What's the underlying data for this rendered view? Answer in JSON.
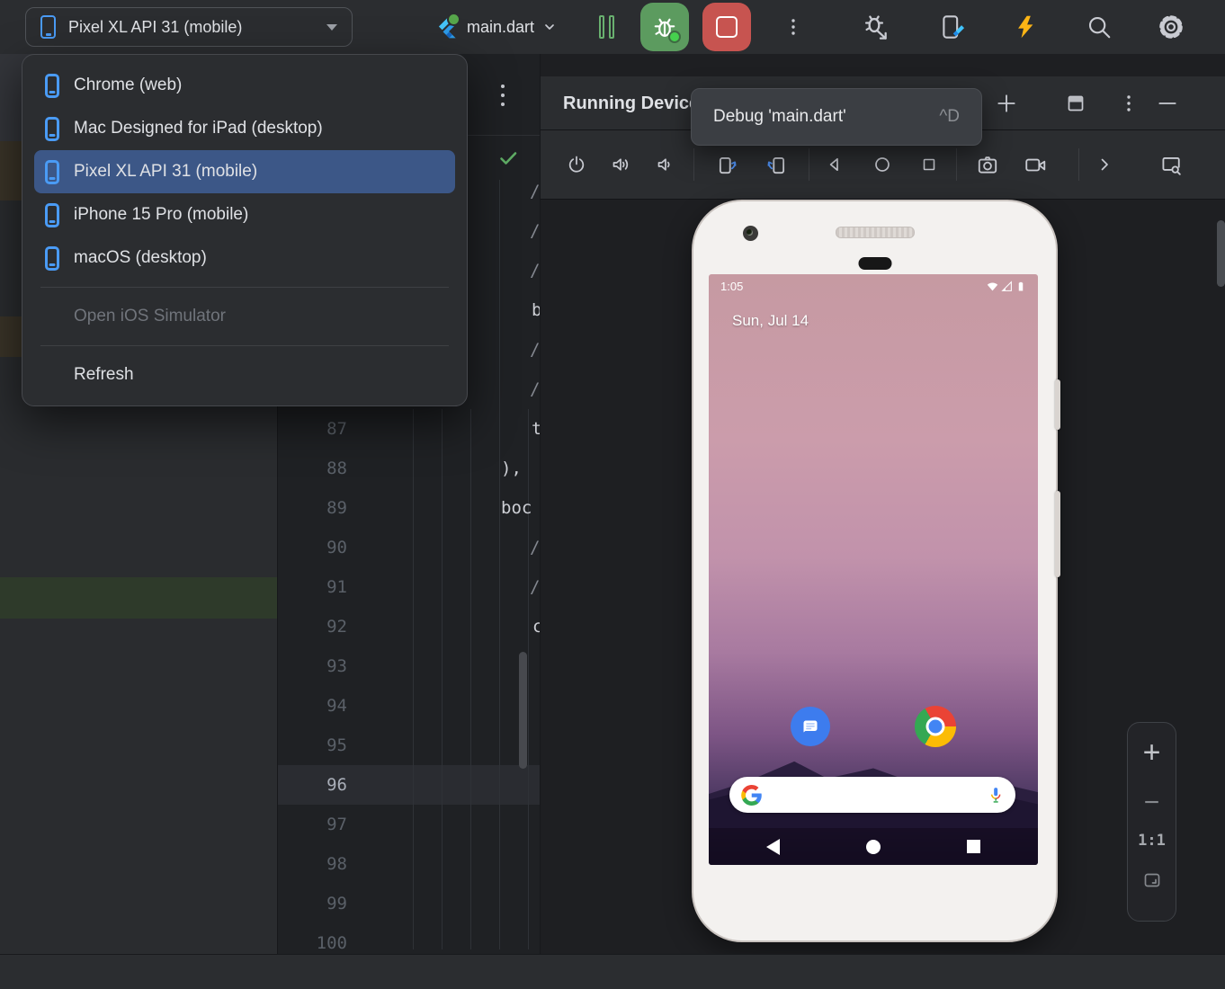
{
  "colors": {
    "accent_blue": "#4A9BF5",
    "selection_blue": "#3C5787",
    "run_green": "#5C9B5F",
    "stop_red": "#C75450",
    "hot_reload_yellow": "#FDB515",
    "check_green": "#5FAD65",
    "toolbar_bg": "#2B2D30",
    "editor_bg": "#1F2124",
    "project_panel_bg": "#2A2C2F"
  },
  "toolbar": {
    "device_selector": {
      "label": "Pixel XL API 31 (mobile)",
      "icon": "device-phone-icon"
    },
    "run_config": {
      "label": "main.dart",
      "icon": "flutter-icon"
    },
    "icons": [
      "pause-icon",
      "debug-icon",
      "stop-icon",
      "more-vertical-icon",
      "attach-debugger-icon",
      "flutter-device-icon",
      "hot-reload-icon",
      "search-icon",
      "settings-icon"
    ]
  },
  "device_menu": {
    "items": [
      {
        "type": "item",
        "label": "Chrome (web)",
        "icon": "device-phone-icon"
      },
      {
        "type": "item",
        "label": "Mac Designed for iPad (desktop)",
        "icon": "device-phone-icon"
      },
      {
        "type": "item",
        "label": "Pixel XL API 31 (mobile)",
        "icon": "device-phone-icon",
        "selected": true
      },
      {
        "type": "item",
        "label": "iPhone 15 Pro (mobile)",
        "icon": "device-phone-icon"
      },
      {
        "type": "item",
        "label": "macOS (desktop)",
        "icon": "device-phone-icon"
      },
      {
        "type": "separator"
      },
      {
        "type": "item",
        "label": "Open iOS Simulator",
        "disabled": true
      },
      {
        "type": "separator"
      },
      {
        "type": "item",
        "label": "Refresh"
      }
    ]
  },
  "tooltip": {
    "text": "Debug 'main.dart'",
    "shortcut": "^D"
  },
  "devices_panel": {
    "title": "Running Devices",
    "header_icons": [
      "add-icon",
      "layout-icon",
      "more-vertical-icon",
      "hide-icon"
    ],
    "emulator_toolbar_icons": [
      "power-icon",
      "volume-up-icon",
      "volume-down-icon",
      "rotate-left-icon",
      "rotate-right-icon",
      "back-icon",
      "home-icon",
      "overview-icon",
      "camera-icon",
      "record-icon",
      "chevron-right-icon",
      "screen-search-icon"
    ],
    "zoom_controls": {
      "zoom_in": "+",
      "zoom_out": "−",
      "actual_size": "1:1",
      "fit": "fit-to-window-icon"
    }
  },
  "editor": {
    "line_numbers": [
      "87",
      "88",
      "89",
      "90",
      "91",
      "92",
      "93",
      "94",
      "95",
      "96",
      "97",
      "98",
      "99",
      "100"
    ],
    "active_line": "96",
    "code_fragments": [
      "/",
      "/",
      "/",
      "b",
      "/",
      "/",
      "t",
      "),",
      "boc",
      "/",
      "/",
      "c"
    ]
  },
  "phone": {
    "status_time": "1:05",
    "date": "Sun, Jul 14",
    "status_icons": [
      "wifi-icon",
      "cellular-icon",
      "battery-icon"
    ],
    "app_icons": [
      "messages-app-icon",
      "chrome-app-icon"
    ],
    "nav_icons": [
      "back-icon",
      "home-icon",
      "overview-icon"
    ]
  }
}
